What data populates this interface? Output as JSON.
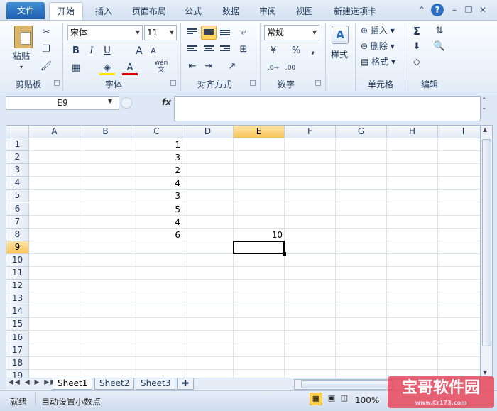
{
  "tabs": {
    "file": "文件",
    "home": "开始",
    "insert": "插入",
    "layout": "页面布局",
    "formulas": "公式",
    "data": "数据",
    "review": "审阅",
    "view": "视图",
    "custom": "新建选项卡"
  },
  "clipboard": {
    "paste": "粘贴",
    "group": "剪贴板"
  },
  "font": {
    "name": "宋体",
    "size": "11",
    "group": "字体",
    "bold": "B",
    "italic": "I",
    "underline": "U",
    "grow": "A",
    "shrink": "A",
    "color_letter": "A",
    "wen": "wén",
    "wen_char": "文"
  },
  "alignment": {
    "group": "对齐方式"
  },
  "number": {
    "format": "常规",
    "group": "数字",
    "percent": "%",
    "comma": ","
  },
  "styles": {
    "label": "样式"
  },
  "cells": {
    "insert": "插入",
    "delete": "删除",
    "format": "格式",
    "group": "单元格"
  },
  "editing": {
    "sum": "Σ",
    "group": "编辑"
  },
  "formula_bar": {
    "name_box": "E9",
    "fx": "fx",
    "value": ""
  },
  "columns": [
    "A",
    "B",
    "C",
    "D",
    "E",
    "F",
    "G",
    "H",
    "I"
  ],
  "rows": [
    "1",
    "2",
    "3",
    "4",
    "5",
    "6",
    "7",
    "8",
    "9",
    "10",
    "11",
    "12",
    "13",
    "14",
    "15",
    "16",
    "17",
    "18",
    "19"
  ],
  "cells_data": [
    {
      "col": "C",
      "row": "1",
      "value": "1"
    },
    {
      "col": "C",
      "row": "2",
      "value": "3"
    },
    {
      "col": "C",
      "row": "3",
      "value": "2"
    },
    {
      "col": "C",
      "row": "4",
      "value": "4"
    },
    {
      "col": "C",
      "row": "5",
      "value": "3"
    },
    {
      "col": "C",
      "row": "6",
      "value": "5"
    },
    {
      "col": "C",
      "row": "7",
      "value": "4"
    },
    {
      "col": "C",
      "row": "8",
      "value": "6"
    },
    {
      "col": "E",
      "row": "8",
      "value": "10"
    }
  ],
  "selected_cell": "E9",
  "sheets": [
    "Sheet1",
    "Sheet2",
    "Sheet3"
  ],
  "active_sheet": "Sheet1",
  "status": {
    "ready": "就绪",
    "auto_decimal": "自动设置小数点",
    "zoom": "100%"
  },
  "watermark": {
    "text": "宝哥软件园",
    "sub": "www.Cr173.com"
  },
  "colors": {
    "file_tab": "#2a6fc0",
    "selection_highlight": "#f9c35a",
    "watermark": "#e6465a"
  }
}
